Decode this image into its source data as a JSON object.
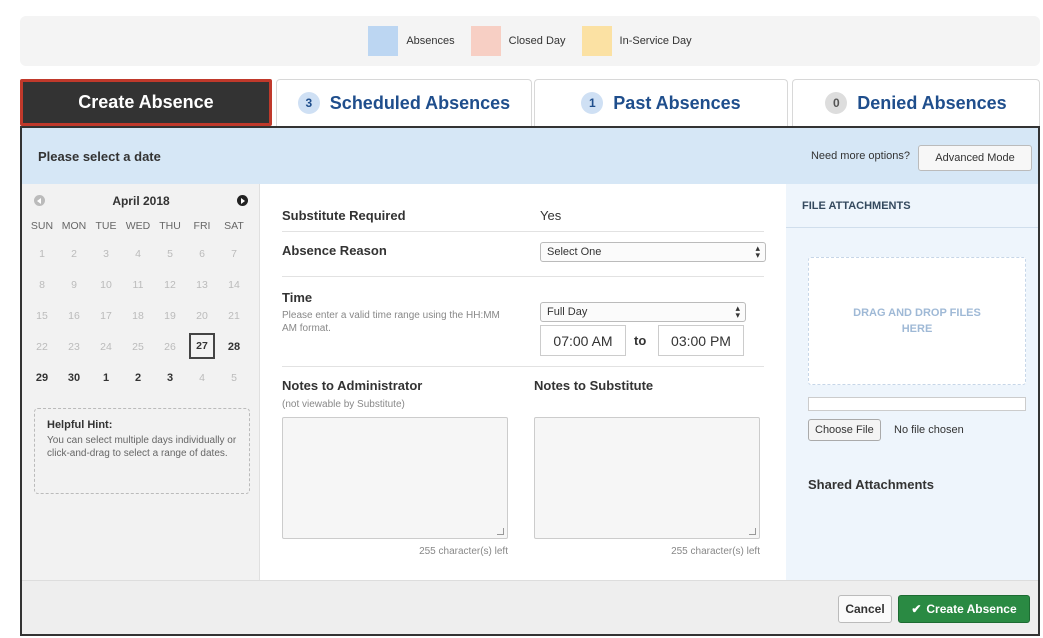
{
  "legend": [
    {
      "label": "Absences",
      "color": "#bcd6f2"
    },
    {
      "label": "Closed Day",
      "color": "#f7cfc4"
    },
    {
      "label": "In-Service Day",
      "color": "#fbe1a3"
    }
  ],
  "tabs": [
    {
      "label": "Create Absence",
      "count": null,
      "active": true
    },
    {
      "label": "Scheduled Absences",
      "count": "3",
      "active": false
    },
    {
      "label": "Past Absences",
      "count": "1",
      "active": false
    },
    {
      "label": "Denied Absences",
      "count": "0",
      "active": false
    }
  ],
  "topbar": {
    "title": "Please select a date",
    "more_options": "Need more options?",
    "advanced_label": "Advanced Mode"
  },
  "calendar": {
    "month_label": "April 2018",
    "weekdays": [
      "SUN",
      "MON",
      "TUE",
      "WED",
      "THU",
      "FRI",
      "SAT"
    ],
    "days": [
      {
        "d": "1",
        "s": "off"
      },
      {
        "d": "2",
        "s": "off"
      },
      {
        "d": "3",
        "s": "off"
      },
      {
        "d": "4",
        "s": "off"
      },
      {
        "d": "5",
        "s": "off"
      },
      {
        "d": "6",
        "s": "off"
      },
      {
        "d": "7",
        "s": "off"
      },
      {
        "d": "8",
        "s": "off"
      },
      {
        "d": "9",
        "s": "off"
      },
      {
        "d": "10",
        "s": "off"
      },
      {
        "d": "11",
        "s": "off"
      },
      {
        "d": "12",
        "s": "off"
      },
      {
        "d": "13",
        "s": "off"
      },
      {
        "d": "14",
        "s": "off"
      },
      {
        "d": "15",
        "s": "off"
      },
      {
        "d": "16",
        "s": "off"
      },
      {
        "d": "17",
        "s": "off"
      },
      {
        "d": "18",
        "s": "off"
      },
      {
        "d": "19",
        "s": "off"
      },
      {
        "d": "20",
        "s": "off"
      },
      {
        "d": "21",
        "s": "off"
      },
      {
        "d": "22",
        "s": "off"
      },
      {
        "d": "23",
        "s": "off"
      },
      {
        "d": "24",
        "s": "off"
      },
      {
        "d": "25",
        "s": "off"
      },
      {
        "d": "26",
        "s": "off"
      },
      {
        "d": "27",
        "s": "today"
      },
      {
        "d": "28",
        "s": "avail"
      },
      {
        "d": "29",
        "s": "avail"
      },
      {
        "d": "30",
        "s": "avail"
      },
      {
        "d": "1",
        "s": "avail"
      },
      {
        "d": "2",
        "s": "avail"
      },
      {
        "d": "3",
        "s": "avail"
      },
      {
        "d": "4",
        "s": "off"
      },
      {
        "d": "5",
        "s": "off"
      }
    ],
    "hint_title": "Helpful Hint:",
    "hint_text": "You can select multiple days individually or click-and-drag to select a range of dates."
  },
  "form": {
    "substitute_label": "Substitute Required",
    "substitute_value": "Yes",
    "reason_label": "Absence Reason",
    "reason_value": "Select One",
    "time_label": "Time",
    "time_help": "Please enter a valid time range using the HH:MM AM format.",
    "duration_value": "Full Day",
    "start_time": "07:00 AM",
    "to_label": "to",
    "end_time": "03:00 PM",
    "notes_admin_label": "Notes to Administrator",
    "notes_admin_sub": "(not viewable by Substitute)",
    "notes_admin_counter": "255 character(s) left",
    "notes_sub_label": "Notes to Substitute",
    "notes_sub_counter": "255 character(s) left"
  },
  "attachments": {
    "header": "FILE ATTACHMENTS",
    "dropzone_text": "DRAG AND DROP FILES HERE",
    "choose_label": "Choose File",
    "no_file": "No file chosen",
    "shared_label": "Shared Attachments"
  },
  "footer": {
    "cancel_label": "Cancel",
    "create_label": "Create Absence"
  }
}
